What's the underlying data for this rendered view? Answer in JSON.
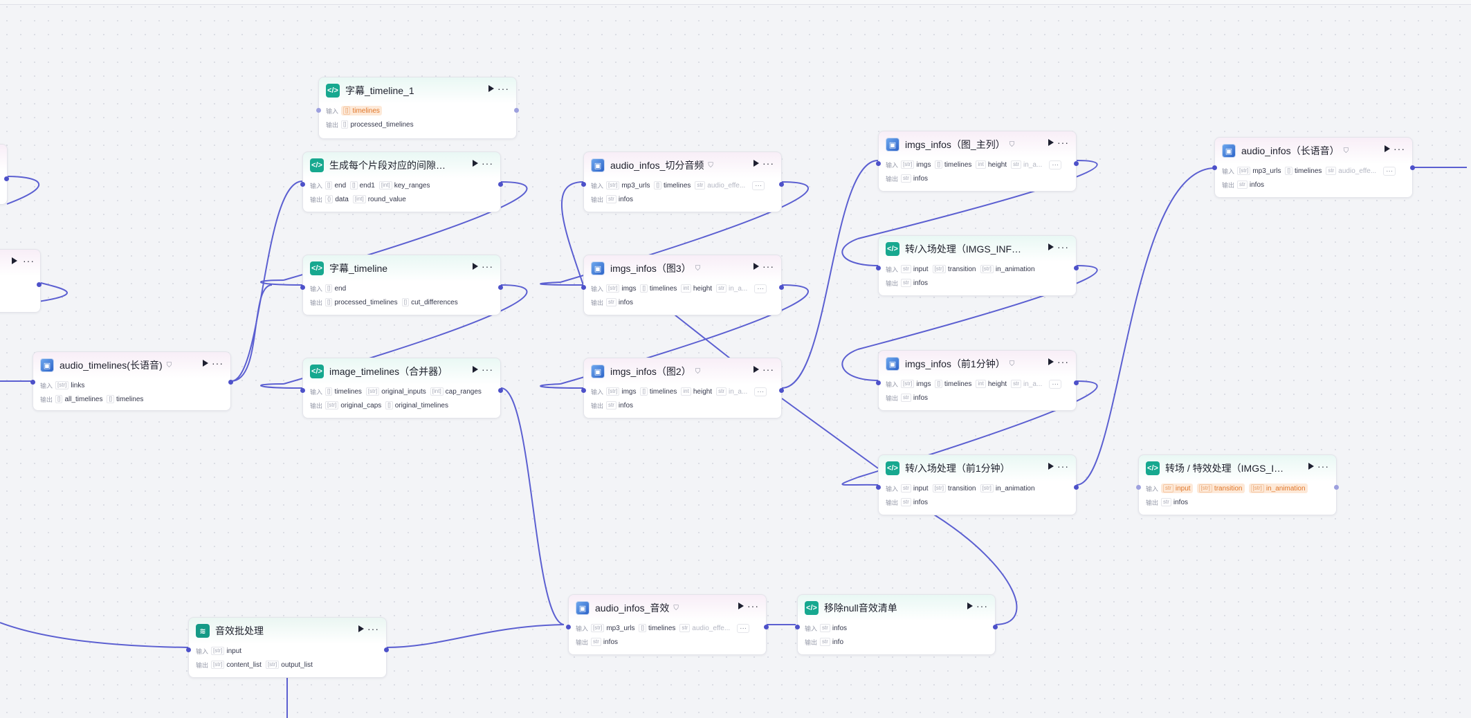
{
  "labels": {
    "input": "输入",
    "output": "输出",
    "more": "···"
  },
  "nodes": [
    {
      "id": "zimu_timeline_1",
      "title": "字幕_timeline_1",
      "kind": "code",
      "icon": "code-icon",
      "inputs": [
        {
          "type": "[]",
          "name": "timelines",
          "state": "warn"
        }
      ],
      "outputs": [
        {
          "type": "[]",
          "name": "processed_timelines"
        }
      ]
    },
    {
      "id": "jianxi_bianliang",
      "title": "生成每个片段对应的间隙变量值",
      "kind": "code",
      "icon": "code-icon",
      "inputs": [
        {
          "type": "[]",
          "name": "end"
        },
        {
          "type": "[]",
          "name": "end1"
        },
        {
          "type": "[int]",
          "name": "key_ranges"
        }
      ],
      "outputs": [
        {
          "type": "{}",
          "name": "data"
        },
        {
          "type": "[int]",
          "name": "round_value"
        }
      ]
    },
    {
      "id": "zimu_timeline",
      "title": "字幕_timeline",
      "kind": "code",
      "icon": "code-icon",
      "inputs": [
        {
          "type": "[]",
          "name": "end"
        }
      ],
      "outputs": [
        {
          "type": "[]",
          "name": "processed_timelines"
        },
        {
          "type": "[]",
          "name": "cut_differences"
        }
      ]
    },
    {
      "id": "audio_timelines_long",
      "title": "audio_timelines(长语音)",
      "kind": "plugin",
      "icon": "plugin-icon",
      "badge": "⛉",
      "inputs": [
        {
          "type": "[str]",
          "name": "links"
        }
      ],
      "outputs": [
        {
          "type": "[]",
          "name": "all_timelines"
        },
        {
          "type": "[]",
          "name": "timelines"
        }
      ]
    },
    {
      "id": "image_timelines_merge",
      "title": "image_timelines（合并器）",
      "kind": "code",
      "icon": "code-icon",
      "inputs": [
        {
          "type": "[]",
          "name": "timelines"
        },
        {
          "type": "[str]",
          "name": "original_inputs"
        },
        {
          "type": "[int]",
          "name": "cap_ranges"
        }
      ],
      "outputs": [
        {
          "type": "[str]",
          "name": "original_caps"
        },
        {
          "type": "[]",
          "name": "original_timelines"
        }
      ]
    },
    {
      "id": "audio_infos_cut",
      "title": "audio_infos_切分音频",
      "kind": "plugin",
      "icon": "plugin-icon",
      "badge": "⛉",
      "inputs": [
        {
          "type": "[str]",
          "name": "mp3_urls"
        },
        {
          "type": "[]",
          "name": "timelines"
        },
        {
          "type": "str",
          "name": "audio_effe...",
          "state": "fade"
        }
      ],
      "outputs": [
        {
          "type": "str",
          "name": "infos"
        }
      ],
      "more_inputs": "···"
    },
    {
      "id": "imgs_infos_3",
      "title": "imgs_infos（图3）",
      "kind": "plugin",
      "icon": "plugin-icon",
      "badge": "⛉",
      "inputs": [
        {
          "type": "[str]",
          "name": "imgs"
        },
        {
          "type": "[]",
          "name": "timelines"
        },
        {
          "type": "int",
          "name": "height"
        },
        {
          "type": "str",
          "name": "in_a...",
          "state": "fade"
        }
      ],
      "outputs": [
        {
          "type": "str",
          "name": "infos"
        }
      ],
      "more_inputs": "···"
    },
    {
      "id": "imgs_infos_2",
      "title": "imgs_infos（图2）",
      "kind": "plugin",
      "icon": "plugin-icon",
      "badge": "⛉",
      "inputs": [
        {
          "type": "[str]",
          "name": "imgs"
        },
        {
          "type": "[]",
          "name": "timelines"
        },
        {
          "type": "int",
          "name": "height"
        },
        {
          "type": "str",
          "name": "in_a...",
          "state": "fade"
        }
      ],
      "outputs": [
        {
          "type": "str",
          "name": "infos"
        }
      ],
      "more_inputs": "···"
    },
    {
      "id": "imgs_infos_main",
      "title": "imgs_infos（图_主列）",
      "kind": "plugin",
      "icon": "plugin-icon",
      "badge": "⛉",
      "inputs": [
        {
          "type": "[str]",
          "name": "imgs"
        },
        {
          "type": "[]",
          "name": "timelines"
        },
        {
          "type": "int",
          "name": "height"
        },
        {
          "type": "str",
          "name": "in_a...",
          "state": "fade"
        }
      ],
      "outputs": [
        {
          "type": "str",
          "name": "infos"
        }
      ],
      "more_inputs": "···"
    },
    {
      "id": "zhuan_ruchang_1",
      "title": "转/入场处理（IMGS_INFOS）_1",
      "kind": "code",
      "icon": "code-icon",
      "inputs": [
        {
          "type": "str",
          "name": "input"
        },
        {
          "type": "[str]",
          "name": "transition"
        },
        {
          "type": "[str]",
          "name": "in_animation"
        }
      ],
      "outputs": [
        {
          "type": "str",
          "name": "infos"
        }
      ]
    },
    {
      "id": "imgs_infos_first_min",
      "title": "imgs_infos（前1分钟）",
      "kind": "plugin",
      "icon": "plugin-icon",
      "badge": "⛉",
      "inputs": [
        {
          "type": "[str]",
          "name": "imgs"
        },
        {
          "type": "[]",
          "name": "timelines"
        },
        {
          "type": "int",
          "name": "height"
        },
        {
          "type": "str",
          "name": "in_a...",
          "state": "fade"
        }
      ],
      "outputs": [
        {
          "type": "str",
          "name": "infos"
        }
      ],
      "more_inputs": "···"
    },
    {
      "id": "zhuan_ruchang_first_min",
      "title": "转/入场处理（前1分钟）",
      "kind": "code",
      "icon": "code-icon",
      "inputs": [
        {
          "type": "str",
          "name": "input"
        },
        {
          "type": "[str]",
          "name": "transition"
        },
        {
          "type": "[str]",
          "name": "in_animation"
        }
      ],
      "outputs": [
        {
          "type": "str",
          "name": "infos"
        }
      ]
    },
    {
      "id": "audio_infos_long",
      "title": "audio_infos（长语音）",
      "kind": "plugin",
      "icon": "plugin-icon",
      "badge": "⛉",
      "inputs": [
        {
          "type": "[str]",
          "name": "mp3_urls"
        },
        {
          "type": "[]",
          "name": "timelines"
        },
        {
          "type": "str",
          "name": "audio_effe...",
          "state": "fade"
        }
      ],
      "outputs": [
        {
          "type": "str",
          "name": "infos"
        }
      ],
      "more_inputs": "···"
    },
    {
      "id": "zhuanchang_texiao",
      "title": "转场 / 特效处理（IMGS_INFOS···",
      "kind": "code",
      "icon": "code-icon",
      "inputs": [
        {
          "type": "str",
          "name": "input",
          "state": "warn"
        },
        {
          "type": "[str]",
          "name": "transition",
          "state": "warn"
        },
        {
          "type": "[str]",
          "name": "in_animation",
          "state": "warn"
        }
      ],
      "outputs": [
        {
          "type": "str",
          "name": "infos"
        }
      ]
    },
    {
      "id": "yinxiao_batch",
      "title": "音效批处理",
      "kind": "batch",
      "icon": "batch-icon",
      "inputs": [
        {
          "type": "[str]",
          "name": "input"
        }
      ],
      "outputs": [
        {
          "type": "[str]",
          "name": "content_list"
        },
        {
          "type": "[str]",
          "name": "output_list"
        }
      ]
    },
    {
      "id": "audio_infos_sfx",
      "title": "audio_infos_音效",
      "kind": "plugin",
      "icon": "plugin-icon",
      "badge": "⛉",
      "inputs": [
        {
          "type": "[str]",
          "name": "mp3_urls"
        },
        {
          "type": "[]",
          "name": "timelines"
        },
        {
          "type": "str",
          "name": "audio_effe...",
          "state": "fade"
        }
      ],
      "outputs": [
        {
          "type": "str",
          "name": "infos"
        }
      ],
      "more_inputs": "···"
    },
    {
      "id": "remove_null_sfx",
      "title": "移除null音效清单",
      "kind": "code",
      "icon": "code-icon",
      "inputs": [
        {
          "type": "str",
          "name": "infos"
        }
      ],
      "outputs": [
        {
          "type": "str",
          "name": "info"
        }
      ]
    },
    {
      "id": "partial_left_a",
      "title": "",
      "kind": "plugin",
      "icon": "",
      "inputs": [],
      "outputs": []
    },
    {
      "id": "partial_left_b",
      "title": "",
      "kind": "plugin",
      "icon": "",
      "inputs": [],
      "outputs": []
    }
  ]
}
